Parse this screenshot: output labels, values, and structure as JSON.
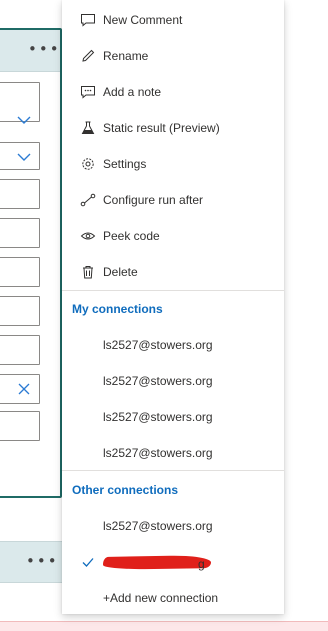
{
  "menu": {
    "items": [
      {
        "label": "New Comment",
        "icon": "comment-icon"
      },
      {
        "label": "Rename",
        "icon": "pencil-icon"
      },
      {
        "label": "Add a note",
        "icon": "note-icon"
      },
      {
        "label": "Static result (Preview)",
        "icon": "flask-icon"
      },
      {
        "label": "Settings",
        "icon": "gear-icon"
      },
      {
        "label": "Configure run after",
        "icon": "run-after-icon"
      },
      {
        "label": "Peek code",
        "icon": "eye-icon"
      },
      {
        "label": "Delete",
        "icon": "trash-icon"
      }
    ],
    "my_connections": {
      "title": "My connections",
      "items": [
        "ls2527@stowers.org",
        "ls2527@stowers.org",
        "ls2527@stowers.org",
        "ls2527@stowers.org"
      ]
    },
    "other_connections": {
      "title": "Other connections",
      "items": [
        "ls2527@stowers.org"
      ],
      "selected_tail": "g",
      "add_label": "+Add new connection"
    }
  },
  "colors": {
    "accent": "#0f6cbd",
    "card_border": "#1f6b66",
    "card_header": "#dbe9eb",
    "redaction": "#e0201a"
  }
}
